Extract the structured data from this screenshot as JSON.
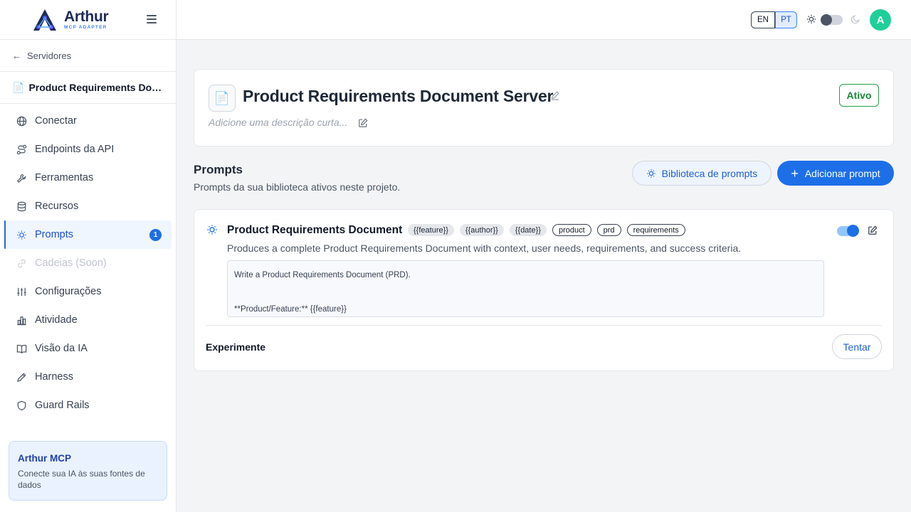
{
  "brand": {
    "name": "Arthur",
    "subtitle": "MCP ADAPTER"
  },
  "sidebar": {
    "back_label": "Servidores",
    "server_name": "Product Requirements Document Server",
    "items": [
      {
        "label": "Conectar",
        "icon": "globe-icon"
      },
      {
        "label": "Endpoints da API",
        "icon": "route-icon"
      },
      {
        "label": "Ferramentas",
        "icon": "wrench-icon"
      },
      {
        "label": "Recursos",
        "icon": "database-icon"
      },
      {
        "label": "Prompts",
        "icon": "lightbulb-icon",
        "badge": "1",
        "active": true
      },
      {
        "label": "Cadeias (Soon)",
        "icon": "link-icon",
        "disabled": true
      },
      {
        "label": "Configurações",
        "icon": "sliders-icon"
      },
      {
        "label": "Atividade",
        "icon": "bar-chart-icon"
      },
      {
        "label": "Visão da IA",
        "icon": "book-open-icon"
      },
      {
        "label": "Harness",
        "icon": "pencil-ruler-icon"
      },
      {
        "label": "Guard Rails",
        "icon": "shield-icon"
      }
    ],
    "promo": {
      "title": "Arthur MCP",
      "text": "Conecte sua IA às suas fontes de dados"
    }
  },
  "topbar": {
    "lang_en": "EN",
    "lang_pt": "PT",
    "selected_lang": "PT",
    "avatar_initial": "A",
    "avatar_color": "#1fcf9a"
  },
  "server": {
    "title": "Product Requirements Document Server",
    "description_placeholder": "Adicione uma descrição curta...",
    "status": "Ativo",
    "status_color": "#22a048"
  },
  "section": {
    "title": "Prompts",
    "subtitle": "Prompts da sua biblioteca ativos neste projeto.",
    "library_button": "Biblioteca de prompts",
    "add_button": "Adicionar prompt"
  },
  "prompt": {
    "title": "Product Requirements Document",
    "variables": [
      "{{feature}}",
      "{{author}}",
      "{{date}}"
    ],
    "keywords": [
      "product",
      "prd",
      "requirements"
    ],
    "enabled": true,
    "description": "Produces a complete Product Requirements Document with context, user needs, requirements, and success criteria.",
    "content_line1": "Write a Product Requirements Document (PRD).",
    "content_line2": "**Product/Feature:** {{feature}}",
    "try_label": "Experimente",
    "try_button": "Tentar"
  },
  "accent_color": "#1d6fe8"
}
